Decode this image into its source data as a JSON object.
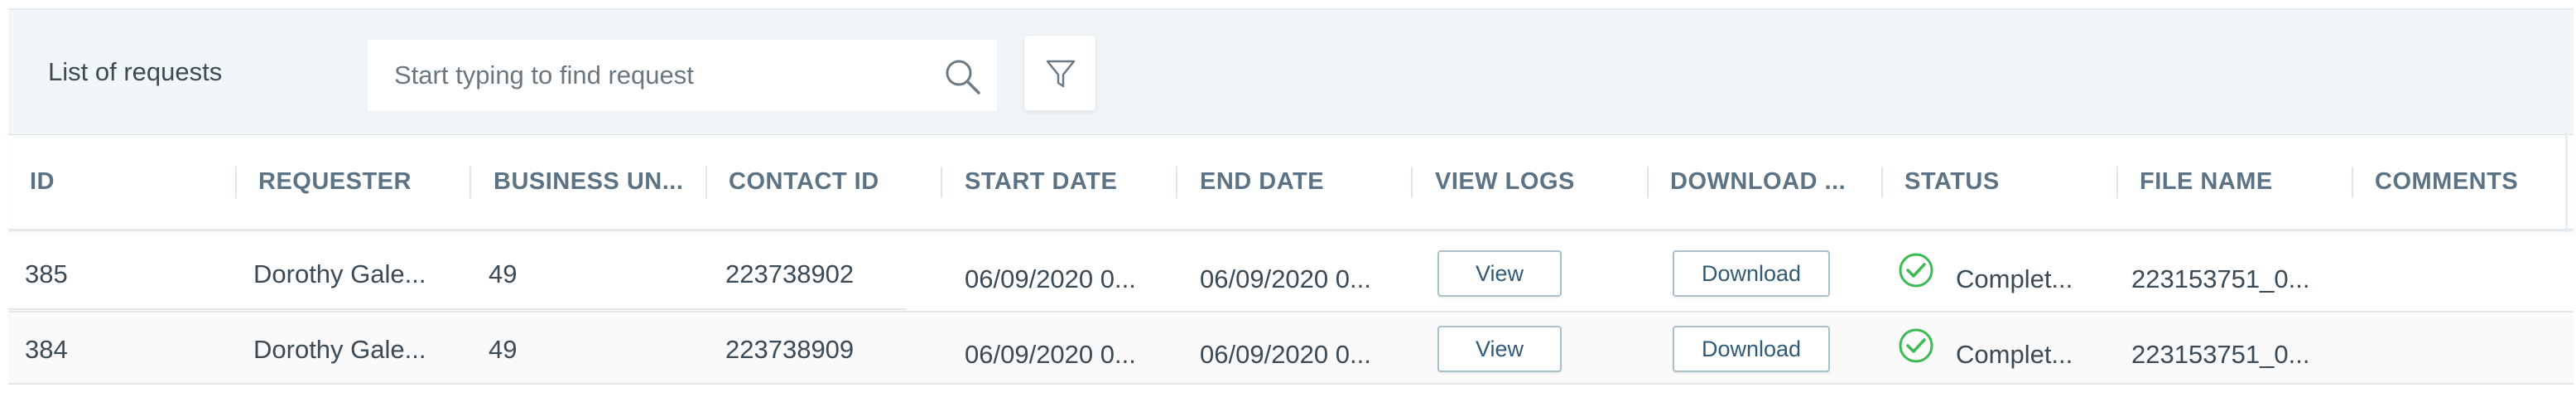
{
  "toolbar": {
    "title": "List of requests",
    "search_placeholder": "Start typing to find request"
  },
  "table": {
    "columns": [
      "ID",
      "REQUESTER",
      "BUSINESS UN...",
      "CONTACT ID",
      "START DATE",
      "END DATE",
      "VIEW LOGS",
      "DOWNLOAD ...",
      "STATUS",
      "FILE NAME",
      "COMMENTS"
    ],
    "rows": [
      {
        "id": "385",
        "requester": "Dorothy Gale...",
        "business_unit": "49",
        "contact_id": "223738902",
        "start_date": "06/09/2020 0...",
        "end_date": "06/09/2020 0...",
        "view_label": "View",
        "download_label": "Download",
        "status": "Complet...",
        "status_icon": "check-circle-icon",
        "file_name": "223153751_0...",
        "comments": ""
      },
      {
        "id": "384",
        "requester": "Dorothy Gale...",
        "business_unit": "49",
        "contact_id": "223738909",
        "start_date": "06/09/2020 0...",
        "end_date": "06/09/2020 0...",
        "view_label": "View",
        "download_label": "Download",
        "status": "Complet...",
        "status_icon": "check-circle-icon",
        "file_name": "223153751_0...",
        "comments": ""
      }
    ]
  },
  "colors": {
    "toolbar_bg": "#f1f6f9",
    "header_text": "#5b7384",
    "status_success": "#3cba54",
    "button_border": "#a9bfcc"
  }
}
